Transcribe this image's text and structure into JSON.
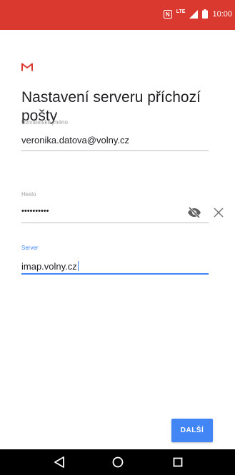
{
  "status_bar": {
    "color": "#d9392f",
    "time": "10:00",
    "lte_label": "LTE",
    "icons": [
      "nfc-icon",
      "lte-signal-icon",
      "battery-icon"
    ]
  },
  "app": {
    "logo": "gmail-logo",
    "title": "Nastavení serveru příchozí pošty"
  },
  "form": {
    "username": {
      "label": "Uživatelské jméno",
      "value": "veronika.datova@volny.cz"
    },
    "password": {
      "label": "Heslo",
      "value": "••••••••••",
      "toggle_icon": "eye-off-icon",
      "clear_icon": "close-icon"
    },
    "server": {
      "label": "Server",
      "value": "imap.volny.cz",
      "focused": true
    }
  },
  "actions": {
    "next_label": "DALŠÍ"
  },
  "nav_bar": {
    "icons": [
      "back-icon",
      "home-icon",
      "recents-icon"
    ]
  },
  "colors": {
    "accent": "#4285f4",
    "gmail_red": "#d9392f",
    "text": "#202124",
    "label": "#9e9e9e"
  }
}
